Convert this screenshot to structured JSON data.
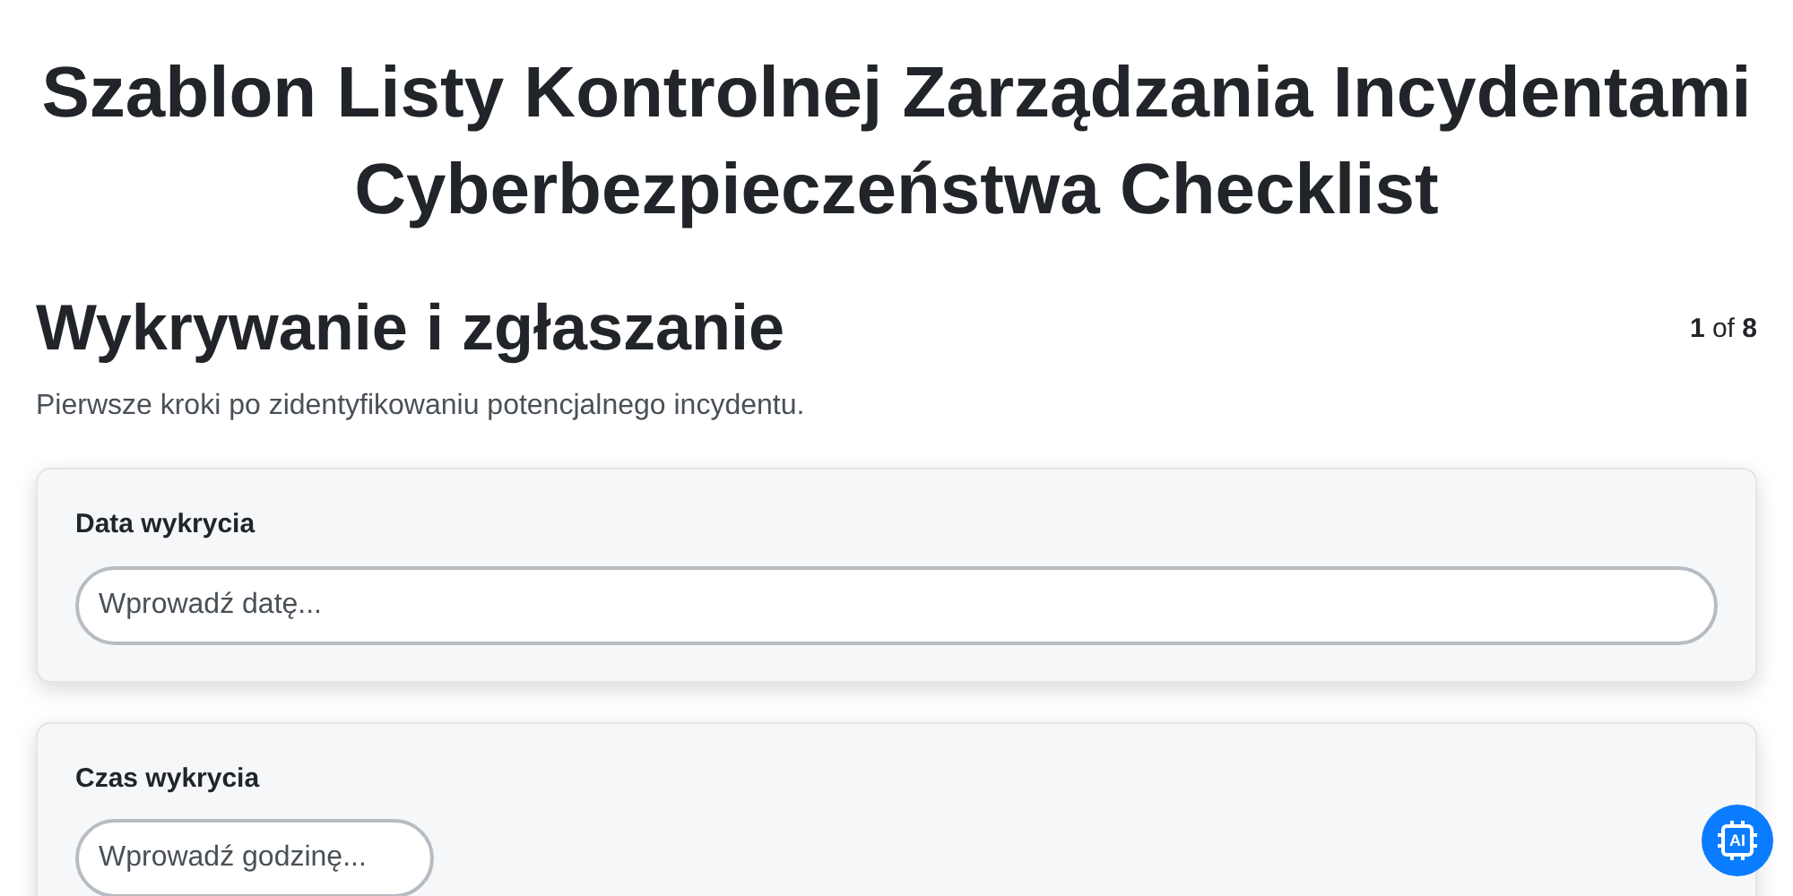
{
  "title": "Szablon Listy Kontrolnej Zarządzania Incydentami Cyberbezpieczeństwa Checklist",
  "section": {
    "heading": "Wykrywanie i zgłaszanie",
    "progress": "**1** of **8**",
    "description": "Pierwsze kroki po zidentyfikowaniu potencjalnego incydentu."
  },
  "fields": [
    {
      "label": "Data wykrycia",
      "placeholder": "Wprowadź datę...",
      "kind": "wide"
    },
    {
      "label": "Czas wykrycia",
      "placeholder": "Wprowadź godzinę...",
      "kind": "narrow"
    }
  ],
  "ai_button": {
    "label": "AI"
  }
}
